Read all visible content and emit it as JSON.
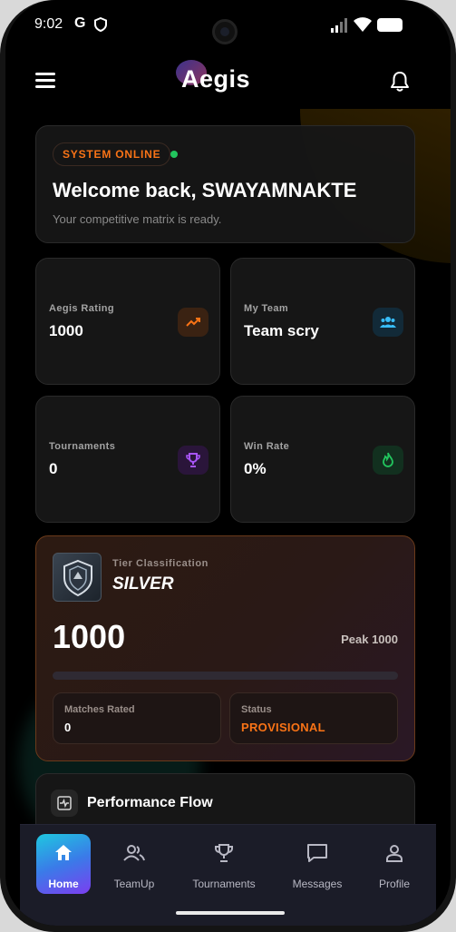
{
  "status_bar": {
    "time": "9:02",
    "g_glyph": "G"
  },
  "header": {
    "logo": "Aegis",
    "menu_icon": "hamburger-icon",
    "notification_icon": "bell-icon"
  },
  "welcome": {
    "badge": "SYSTEM ONLINE",
    "title": "Welcome back, SWAYAMNAKTE",
    "subtitle": "Your competitive matrix is ready."
  },
  "stats": [
    {
      "label": "Aegis Rating",
      "value": "1000",
      "icon": "trending-up-icon",
      "color": "#f97316"
    },
    {
      "label": "My Team",
      "value": "Team scry",
      "icon": "team-icon",
      "color": "#38bdf8"
    },
    {
      "label": "Tournaments",
      "value": "0",
      "icon": "trophy-icon",
      "color": "#a855f7"
    },
    {
      "label": "Win Rate",
      "value": "0%",
      "icon": "flame-icon",
      "color": "#22c55e"
    }
  ],
  "tier": {
    "caption": "Tier Classification",
    "name": "SILVER",
    "rating": "1000",
    "peak": "Peak 1000",
    "progress": 0,
    "matches_label": "Matches Rated",
    "matches_value": "0",
    "status_label": "Status",
    "status_value": "PROVISIONAL"
  },
  "performance": {
    "title": "Performance Flow",
    "icon": "activity-icon"
  },
  "nav": [
    {
      "label": "Home",
      "icon": "home-icon",
      "active": true
    },
    {
      "label": "TeamUp",
      "icon": "users-icon"
    },
    {
      "label": "Tournaments",
      "icon": "trophy-icon"
    },
    {
      "label": "Messages",
      "icon": "message-icon"
    },
    {
      "label": "Profile",
      "icon": "profile-icon"
    }
  ],
  "colors": {
    "accent": "#f97316",
    "online": "#22c55e",
    "background": "#000000"
  }
}
